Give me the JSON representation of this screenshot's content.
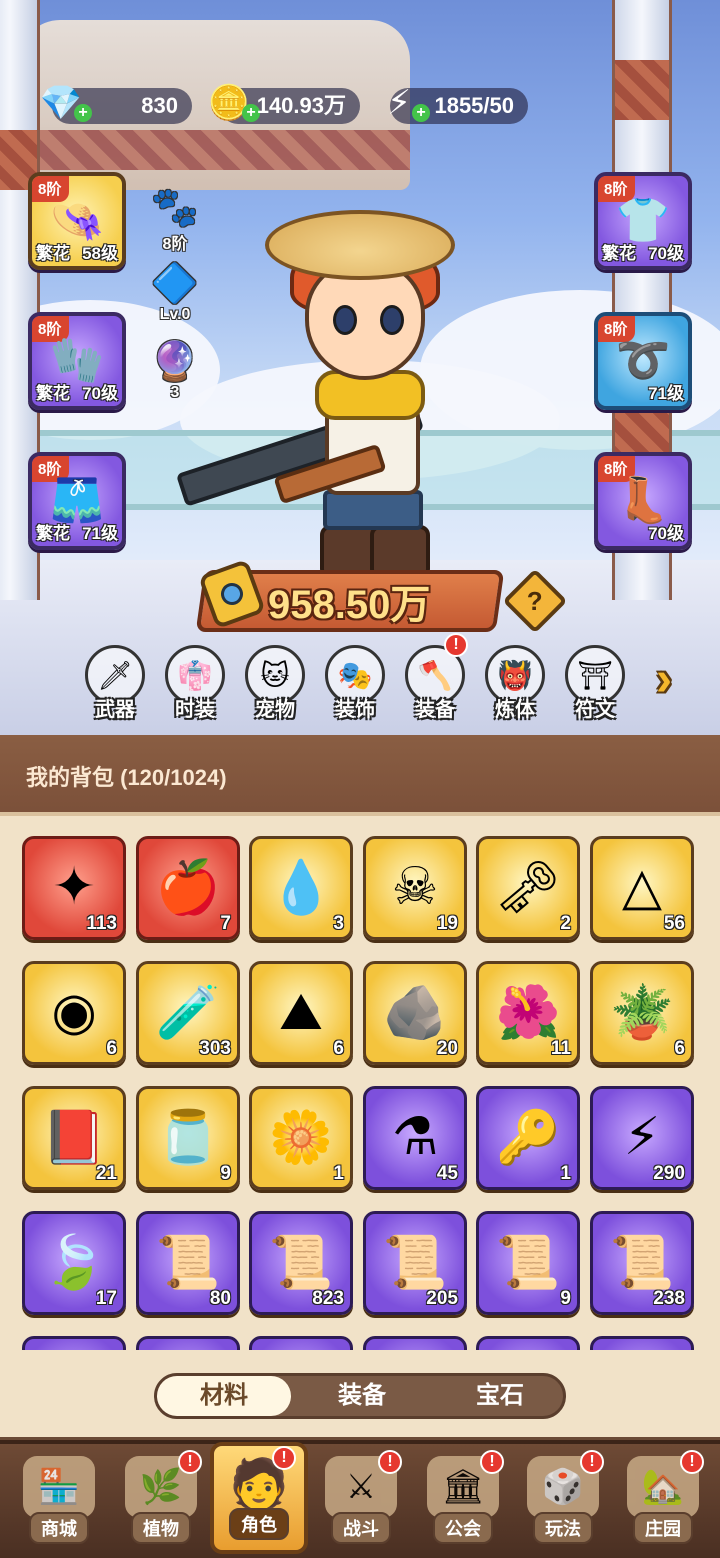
{
  "currency": {
    "gems": "830",
    "gold": "140.93万",
    "energy": "1855/50",
    "gem_icon": "diamond-icon",
    "gold_icon": "coin-icon",
    "energy_icon": "lightning-icon"
  },
  "equipment": {
    "left": [
      {
        "tier": "8阶",
        "quality": "繁花",
        "level": "58级",
        "icon": "hat-icon"
      },
      {
        "tier": "8阶",
        "quality": "繁花",
        "level": "70级",
        "icon": "gloves-icon"
      },
      {
        "tier": "8阶",
        "quality": "繁花",
        "level": "71级",
        "icon": "pants-icon"
      }
    ],
    "right": [
      {
        "tier": "8阶",
        "quality": "繁花",
        "level": "70级",
        "icon": "shirt-icon"
      },
      {
        "tier": "8阶",
        "quality": "",
        "level": "71级",
        "icon": "belt-icon"
      },
      {
        "tier": "8阶",
        "quality": "",
        "level": "70级",
        "icon": "boots-icon"
      }
    ],
    "mini": [
      {
        "label": "8阶",
        "icon": "pet-card-icon"
      },
      {
        "label": "Lv.0",
        "icon": "green-crystal-icon"
      },
      {
        "label": "3",
        "icon": "orb-icon"
      }
    ]
  },
  "power": {
    "value": "958.50万",
    "help": "?"
  },
  "features": [
    {
      "label": "武器",
      "icon": "weapon-icon",
      "badge": ""
    },
    {
      "label": "时装",
      "icon": "costume-icon",
      "badge": ""
    },
    {
      "label": "宠物",
      "icon": "pet-icon",
      "badge": ""
    },
    {
      "label": "装饰",
      "icon": "mask-icon",
      "badge": ""
    },
    {
      "label": "装备",
      "icon": "equipment-icon",
      "badge": "!"
    },
    {
      "label": "炼体",
      "icon": "body-icon",
      "badge": ""
    },
    {
      "label": "符文",
      "icon": "rune-icon",
      "badge": ""
    }
  ],
  "bag": {
    "title": "我的背包 (120/1024)",
    "items": [
      {
        "count": "113",
        "rarity": "red",
        "icon": "crystal-star-icon"
      },
      {
        "count": "7",
        "rarity": "red",
        "icon": "red-potion-icon"
      },
      {
        "count": "3",
        "rarity": "gold",
        "icon": "water-drop-icon"
      },
      {
        "count": "19",
        "rarity": "gold",
        "icon": "skull-scroll-icon"
      },
      {
        "count": "2",
        "rarity": "gold",
        "icon": "gold-key-icon"
      },
      {
        "count": "56",
        "rarity": "gold",
        "icon": "pyramid-icon"
      },
      {
        "count": "6",
        "rarity": "gold",
        "icon": "rune-stone-icon"
      },
      {
        "count": "303",
        "rarity": "gold",
        "icon": "orange-potion-icon"
      },
      {
        "count": "6",
        "rarity": "gold",
        "icon": "gold-pile-icon"
      },
      {
        "count": "20",
        "rarity": "gold",
        "icon": "gold-ore-icon"
      },
      {
        "count": "11",
        "rarity": "gold",
        "icon": "red-flower-icon"
      },
      {
        "count": "6",
        "rarity": "gold",
        "icon": "flower-pot-icon"
      },
      {
        "count": "21",
        "rarity": "gold",
        "icon": "purple-book-icon"
      },
      {
        "count": "9",
        "rarity": "gold",
        "icon": "jar-icon"
      },
      {
        "count": "1",
        "rarity": "gold",
        "icon": "yellow-flower-icon"
      },
      {
        "count": "45",
        "rarity": "purple",
        "icon": "purple-potion-icon"
      },
      {
        "count": "1",
        "rarity": "purple",
        "icon": "silver-key-icon"
      },
      {
        "count": "290",
        "rarity": "purple",
        "icon": "lightning-badge-icon"
      },
      {
        "count": "17",
        "rarity": "purple",
        "icon": "leaf-icon"
      },
      {
        "count": "80",
        "rarity": "purple",
        "icon": "green-scroll-icon"
      },
      {
        "count": "823",
        "rarity": "purple",
        "icon": "purple-scroll-icon"
      },
      {
        "count": "205",
        "rarity": "purple",
        "icon": "blue-scroll-icon"
      },
      {
        "count": "9",
        "rarity": "purple",
        "icon": "red-scroll-icon"
      },
      {
        "count": "238",
        "rarity": "purple",
        "icon": "gold-scroll-icon"
      }
    ],
    "partial_row_count": 6
  },
  "tabs": [
    {
      "label": "材料",
      "active": true
    },
    {
      "label": "装备",
      "active": false
    },
    {
      "label": "宝石",
      "active": false
    }
  ],
  "nav": [
    {
      "label": "商城",
      "icon": "shop-icon",
      "badge": "",
      "active": false
    },
    {
      "label": "植物",
      "icon": "plant-icon",
      "badge": "!",
      "active": false
    },
    {
      "label": "角色",
      "icon": "character-icon",
      "badge": "!",
      "active": true
    },
    {
      "label": "战斗",
      "icon": "battle-icon",
      "badge": "!",
      "active": false
    },
    {
      "label": "公会",
      "icon": "guild-icon",
      "badge": "!",
      "active": false
    },
    {
      "label": "玩法",
      "icon": "gameplay-icon",
      "badge": "!",
      "active": false
    },
    {
      "label": "庄园",
      "icon": "manor-icon",
      "badge": "!",
      "active": false
    }
  ],
  "colors": {
    "gold_rarity": "#f4c43d",
    "purple_rarity": "#7d50dc",
    "red_rarity": "#e0483a",
    "badge_red": "#e6382f"
  }
}
